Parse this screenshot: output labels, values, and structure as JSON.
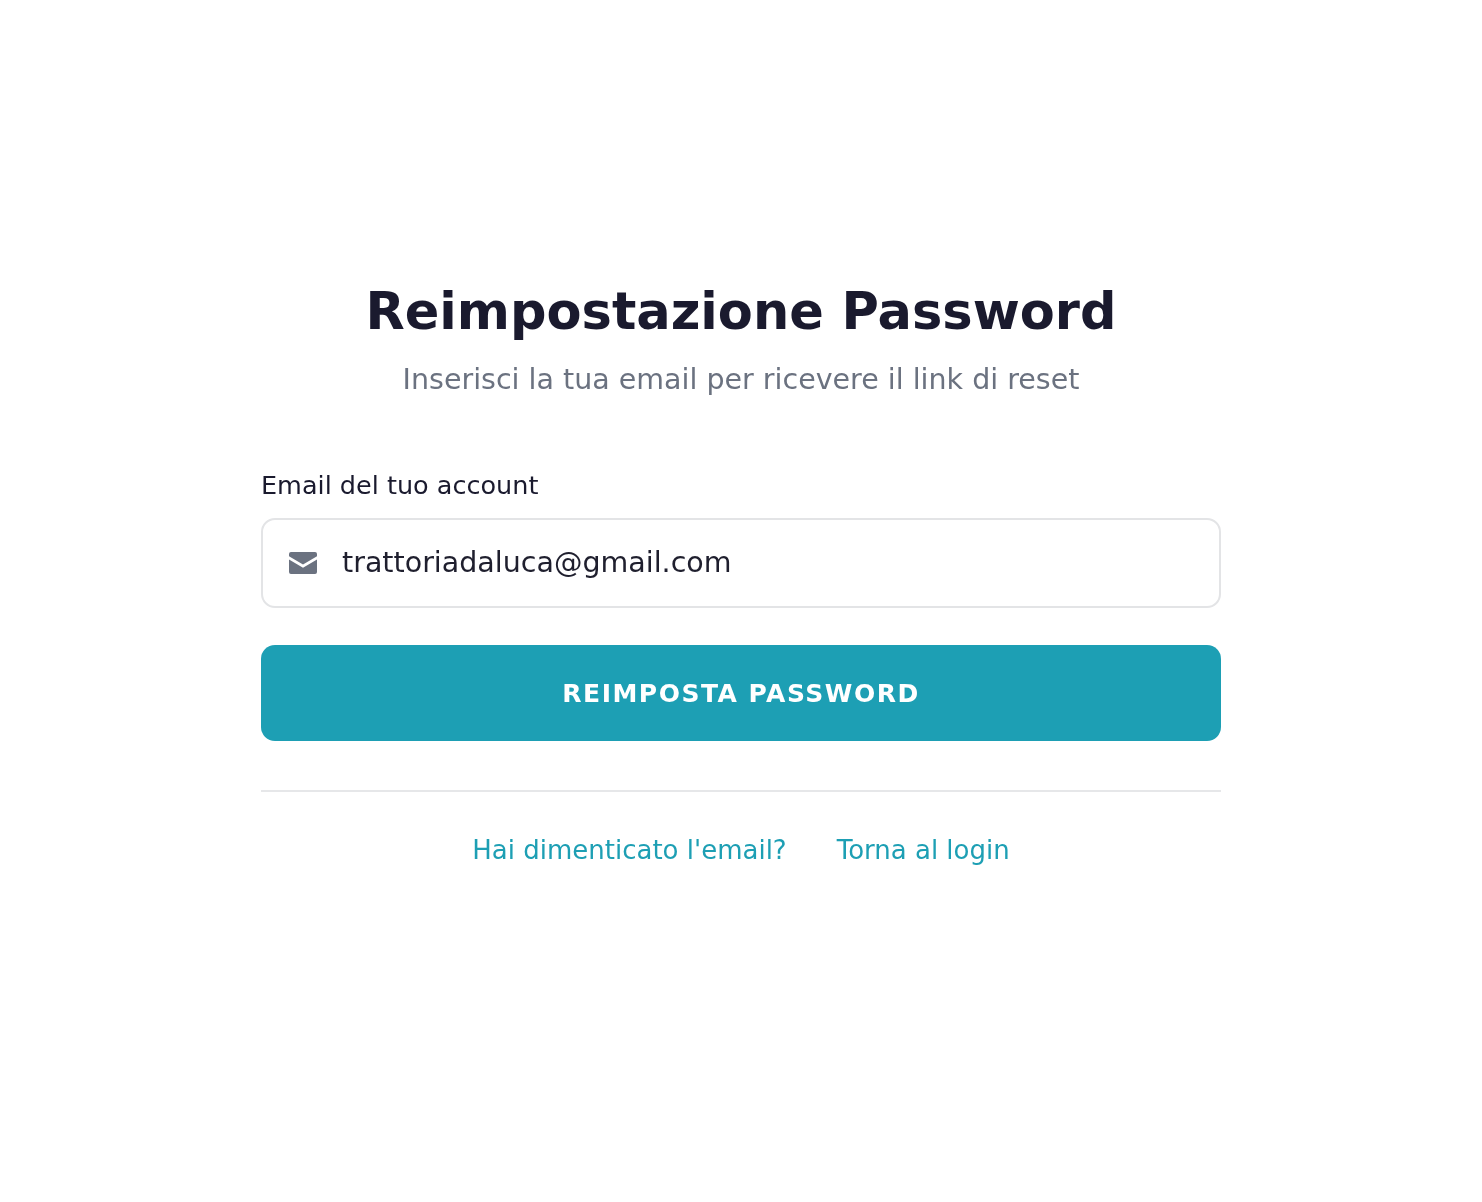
{
  "heading": {
    "title": "Reimpostazione Password",
    "subtitle": "Inserisci la tua email per ricevere il link di reset"
  },
  "form": {
    "email_field": {
      "label": "Email del tuo account",
      "value": "trattoriadaluca@gmail.com"
    },
    "submit_button": "REIMPOSTA PASSWORD"
  },
  "links": [
    "Hai dimenticato l'email?",
    "Torna al login"
  ]
}
